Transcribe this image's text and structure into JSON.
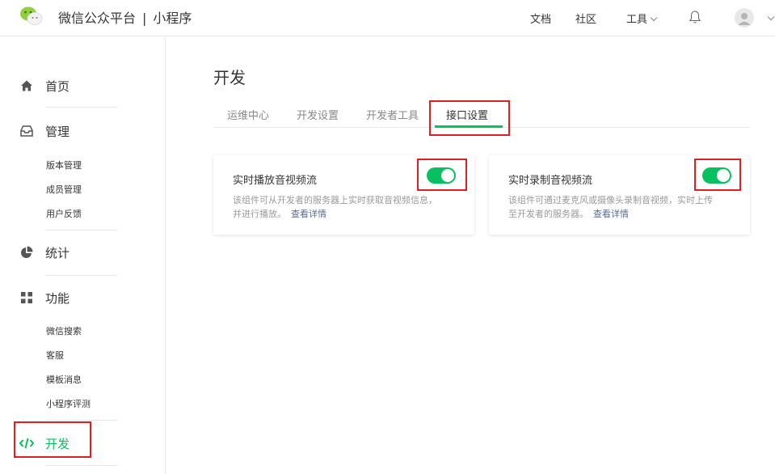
{
  "header": {
    "brand": "微信公众平台",
    "separator": "|",
    "product": "小程序",
    "nav": {
      "docs": "文档",
      "community": "社区",
      "tools": "工具"
    }
  },
  "sidebar": {
    "home": "首页",
    "manage": "管理",
    "manage_items": [
      "版本管理",
      "成员管理",
      "用户反馈"
    ],
    "stats": "统计",
    "features": "功能",
    "features_items": [
      "微信搜索",
      "客服",
      "模板消息",
      "小程序评测"
    ],
    "develop": "开发"
  },
  "main": {
    "title": "开发",
    "tabs": [
      "运维中心",
      "开发设置",
      "开发者工具",
      "接口设置"
    ],
    "active_tab": "接口设置",
    "cards": [
      {
        "title": "实时播放音视频流",
        "desc_line1": "该组件可从开发者的服务器上实时获取音视频信息，",
        "desc_line2": "并进行播放。",
        "link": "查看详情",
        "enabled": true
      },
      {
        "title": "实时录制音视频流",
        "desc_line1": "该组件可通过麦克风或摄像头录制音视频，实时上传",
        "desc_line2": "至开发者的服务器。",
        "link": "查看详情",
        "enabled": true
      }
    ]
  },
  "colors": {
    "accent": "#07c160",
    "highlight": "#e02020",
    "link": "#576b95"
  }
}
